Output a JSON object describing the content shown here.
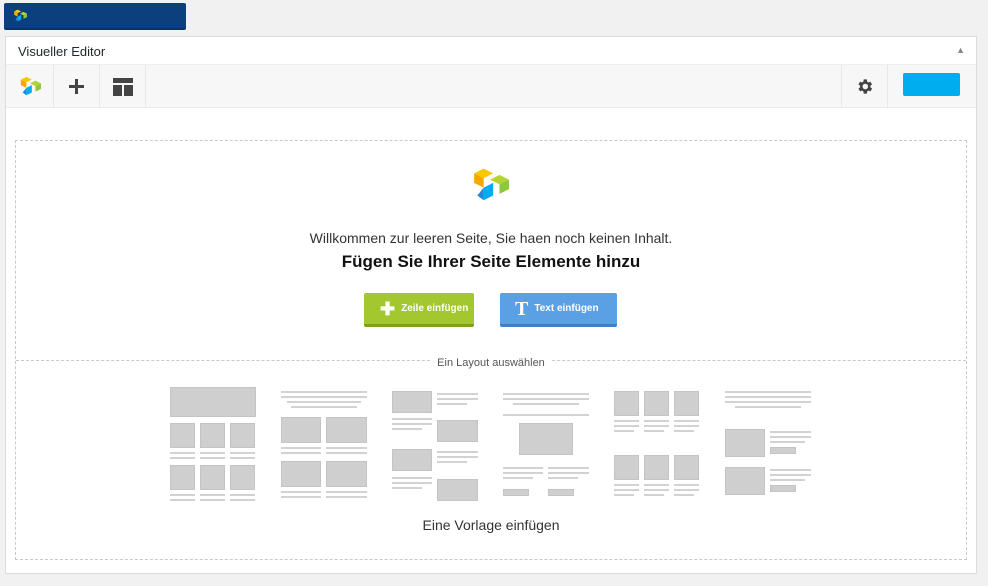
{
  "app": {
    "top_button_icon": "visual-composer-logo-icon",
    "brand_colors": {
      "blue": "#0c3f7e",
      "orange": "#f6a800",
      "yellow": "#f7c700",
      "green": "#8dc63f",
      "sky": "#00aef0"
    }
  },
  "panel": {
    "title": "Visueller Editor",
    "collapse_icon": "triangle-up-icon"
  },
  "toolbar": {
    "logo_icon": "visual-composer-logo-icon",
    "add_icon": "plus-icon",
    "layout_icon": "layout-template-icon",
    "settings_icon": "gear-icon",
    "save_button_color": "#00aef0"
  },
  "welcome": {
    "text": "Willkommen zur leeren Seite, Sie haen noch keinen Inhalt.",
    "heading": "Fügen Sie Ihrer Seite Elemente hinzu",
    "add_row_label": "Zeile einfügen",
    "add_text_label": "Text einfügen",
    "add_row_color": "#a3c72f",
    "add_text_color": "#5ba0e4"
  },
  "layouts": {
    "label": "Ein Layout auswählen",
    "insert_template_label": "Eine Vorlage einfügen"
  }
}
